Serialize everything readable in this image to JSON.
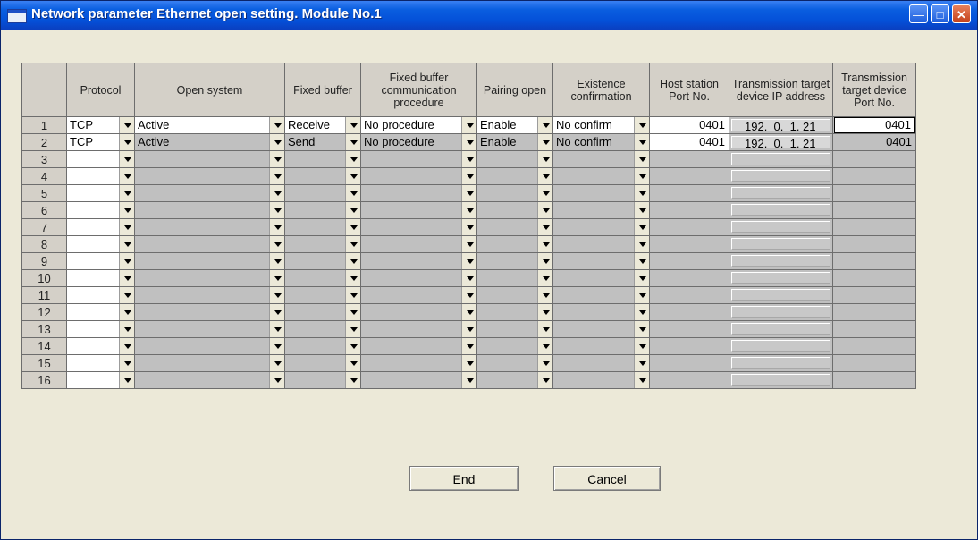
{
  "window": {
    "title": "Network parameter Ethernet open setting. Module No.1",
    "controls": [
      "minimize-icon",
      "maximize-icon",
      "close-icon"
    ]
  },
  "table": {
    "columns": [
      "Protocol",
      "Open system",
      "Fixed buffer",
      "Fixed buffer communication procedure",
      "Pairing open",
      "Existence confirmation",
      "Host station Port No.",
      "Transmission target device IP address",
      "Transmission target device Port No."
    ],
    "rows": [
      {
        "num": "1",
        "protocol": "TCP",
        "open_system": "Active",
        "fixed_buffer": "Receive",
        "procedure": "No procedure",
        "pairing": "Enable",
        "existence": "No confirm",
        "host_port": "0401",
        "ip": "192.  0.  1. 21",
        "target_port": "0401"
      },
      {
        "num": "2",
        "protocol": "TCP",
        "open_system": "Active",
        "fixed_buffer": "Send",
        "procedure": "No procedure",
        "pairing": "Enable",
        "existence": "No confirm",
        "host_port": "0401",
        "ip": "192.  0.  1. 21",
        "target_port": "0401"
      },
      {
        "num": "3",
        "protocol": "",
        "open_system": "",
        "fixed_buffer": "",
        "procedure": "",
        "pairing": "",
        "existence": "",
        "host_port": "",
        "ip": "",
        "target_port": ""
      },
      {
        "num": "4",
        "protocol": "",
        "open_system": "",
        "fixed_buffer": "",
        "procedure": "",
        "pairing": "",
        "existence": "",
        "host_port": "",
        "ip": "",
        "target_port": ""
      },
      {
        "num": "5",
        "protocol": "",
        "open_system": "",
        "fixed_buffer": "",
        "procedure": "",
        "pairing": "",
        "existence": "",
        "host_port": "",
        "ip": "",
        "target_port": ""
      },
      {
        "num": "6",
        "protocol": "",
        "open_system": "",
        "fixed_buffer": "",
        "procedure": "",
        "pairing": "",
        "existence": "",
        "host_port": "",
        "ip": "",
        "target_port": ""
      },
      {
        "num": "7",
        "protocol": "",
        "open_system": "",
        "fixed_buffer": "",
        "procedure": "",
        "pairing": "",
        "existence": "",
        "host_port": "",
        "ip": "",
        "target_port": ""
      },
      {
        "num": "8",
        "protocol": "",
        "open_system": "",
        "fixed_buffer": "",
        "procedure": "",
        "pairing": "",
        "existence": "",
        "host_port": "",
        "ip": "",
        "target_port": ""
      },
      {
        "num": "9",
        "protocol": "",
        "open_system": "",
        "fixed_buffer": "",
        "procedure": "",
        "pairing": "",
        "existence": "",
        "host_port": "",
        "ip": "",
        "target_port": ""
      },
      {
        "num": "10",
        "protocol": "",
        "open_system": "",
        "fixed_buffer": "",
        "procedure": "",
        "pairing": "",
        "existence": "",
        "host_port": "",
        "ip": "",
        "target_port": ""
      },
      {
        "num": "11",
        "protocol": "",
        "open_system": "",
        "fixed_buffer": "",
        "procedure": "",
        "pairing": "",
        "existence": "",
        "host_port": "",
        "ip": "",
        "target_port": ""
      },
      {
        "num": "12",
        "protocol": "",
        "open_system": "",
        "fixed_buffer": "",
        "procedure": "",
        "pairing": "",
        "existence": "",
        "host_port": "",
        "ip": "",
        "target_port": ""
      },
      {
        "num": "13",
        "protocol": "",
        "open_system": "",
        "fixed_buffer": "",
        "procedure": "",
        "pairing": "",
        "existence": "",
        "host_port": "",
        "ip": "",
        "target_port": ""
      },
      {
        "num": "14",
        "protocol": "",
        "open_system": "",
        "fixed_buffer": "",
        "procedure": "",
        "pairing": "",
        "existence": "",
        "host_port": "",
        "ip": "",
        "target_port": ""
      },
      {
        "num": "15",
        "protocol": "",
        "open_system": "",
        "fixed_buffer": "",
        "procedure": "",
        "pairing": "",
        "existence": "",
        "host_port": "",
        "ip": "",
        "target_port": ""
      },
      {
        "num": "16",
        "protocol": "",
        "open_system": "",
        "fixed_buffer": "",
        "procedure": "",
        "pairing": "",
        "existence": "",
        "host_port": "",
        "ip": "",
        "target_port": ""
      }
    ]
  },
  "buttons": {
    "end": "End",
    "cancel": "Cancel"
  }
}
